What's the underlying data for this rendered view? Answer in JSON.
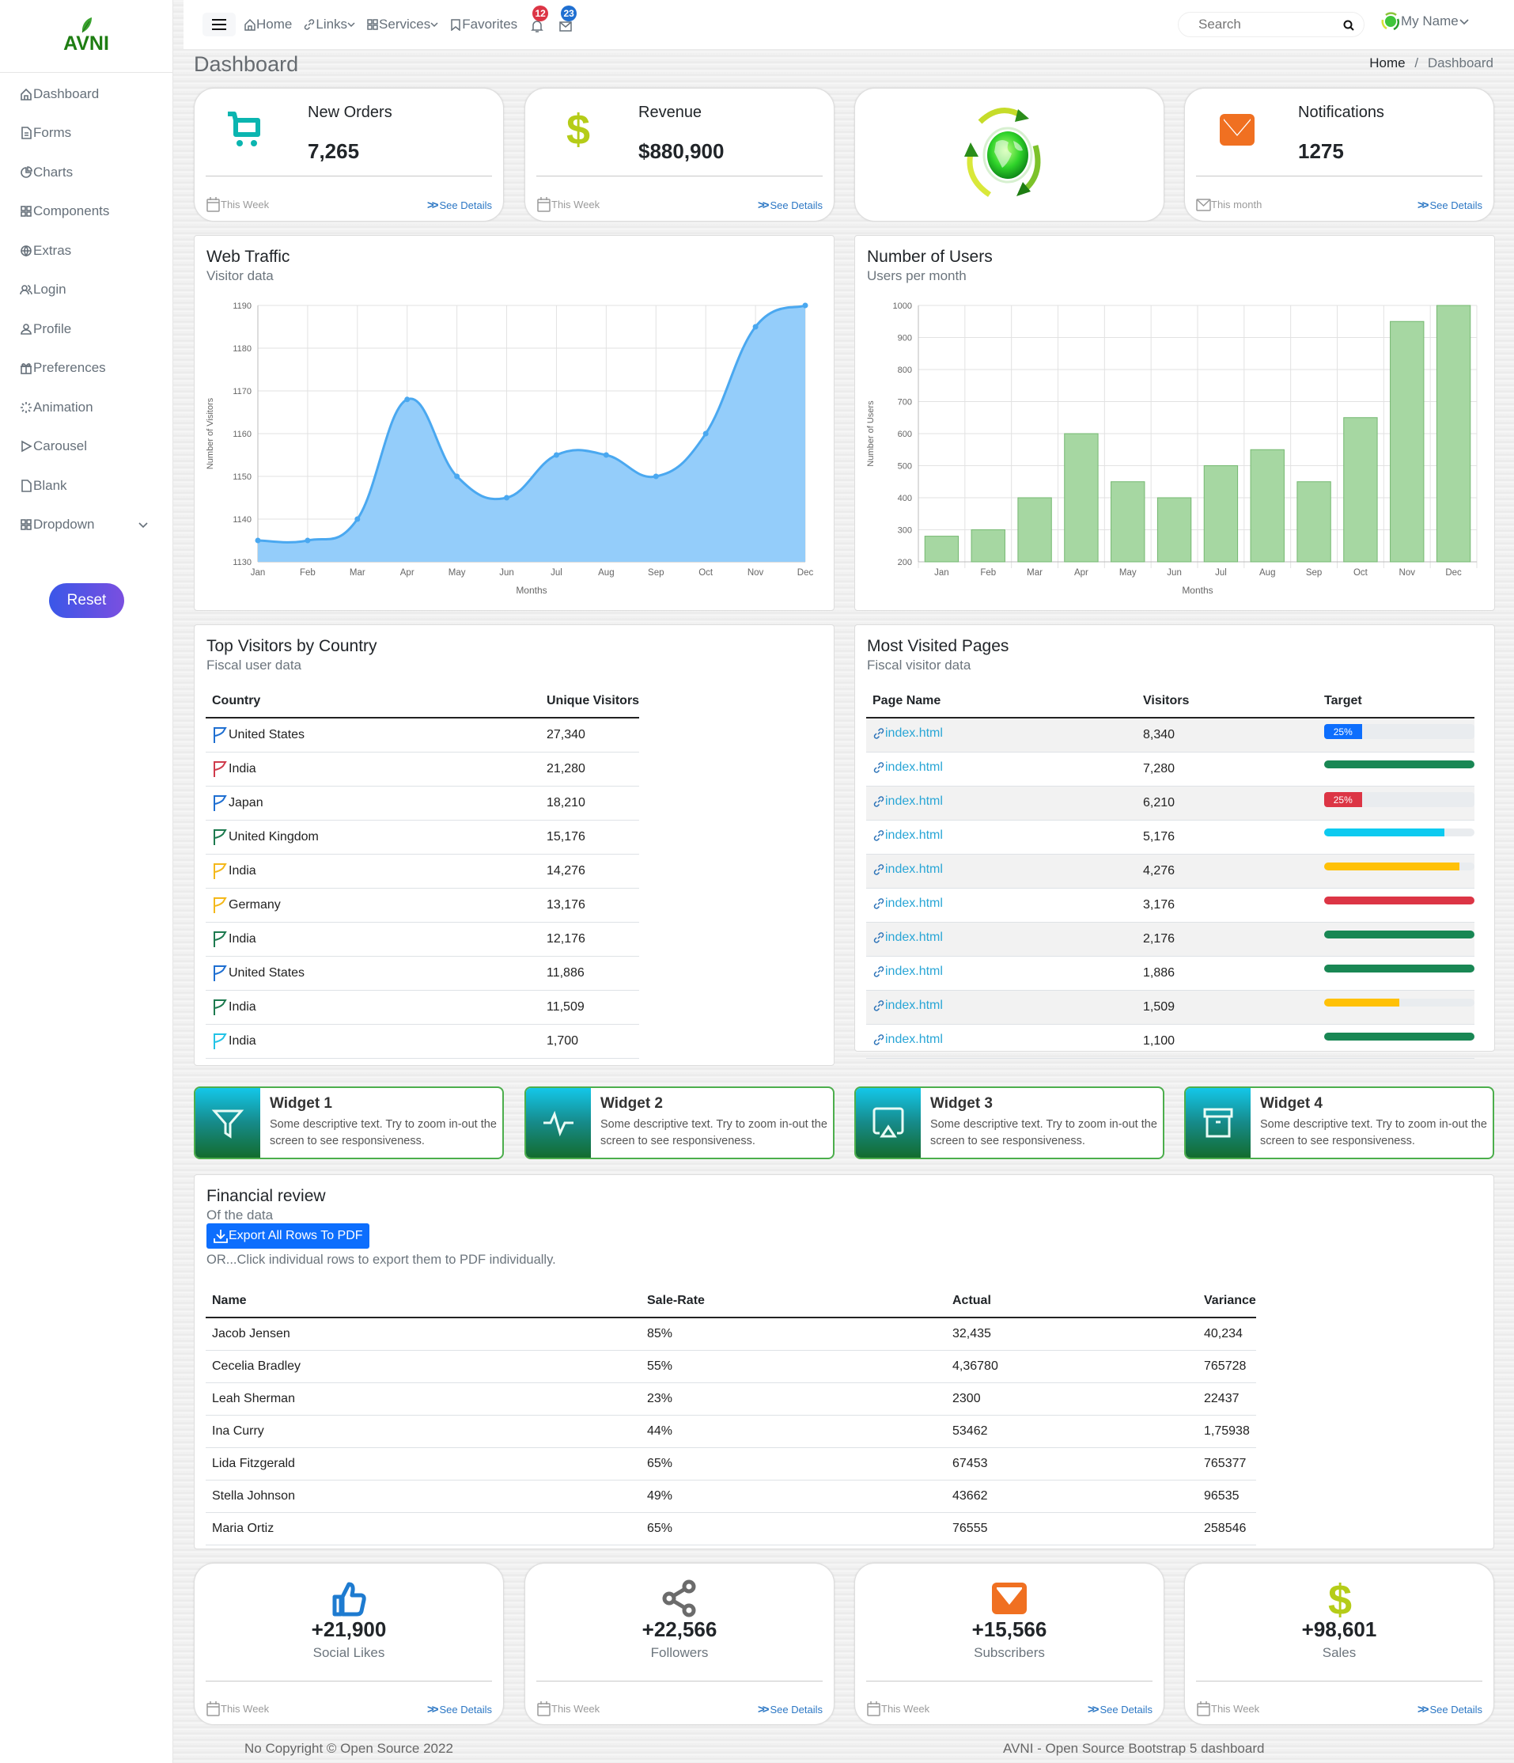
{
  "brand": {
    "name": "AVNI",
    "color": "#1e7d12"
  },
  "sidebar": {
    "items": [
      {
        "label": "Dashboard",
        "icon": "home-icon"
      },
      {
        "label": "Forms",
        "icon": "file-text-icon"
      },
      {
        "label": "Charts",
        "icon": "pie-chart-icon"
      },
      {
        "label": "Components",
        "icon": "grid-icon"
      },
      {
        "label": "Extras",
        "icon": "globe-icon"
      },
      {
        "label": "Login",
        "icon": "users-icon"
      },
      {
        "label": "Profile",
        "icon": "user-icon"
      },
      {
        "label": "Preferences",
        "icon": "gift-icon"
      },
      {
        "label": "Animation",
        "icon": "loader-icon"
      },
      {
        "label": "Carousel",
        "icon": "play-icon"
      },
      {
        "label": "Blank",
        "icon": "file-icon"
      },
      {
        "label": "Dropdown",
        "icon": "grid-icon",
        "has_chevron": true
      }
    ],
    "reset_label": "Reset"
  },
  "header": {
    "nav": [
      {
        "label": "Home",
        "icon": "home-icon"
      },
      {
        "label": "Links",
        "icon": "link-icon",
        "dropdown": true
      },
      {
        "label": "Services",
        "icon": "grid-icon",
        "dropdown": true
      },
      {
        "label": "Favorites",
        "icon": "bookmark-icon"
      }
    ],
    "notifications_count": "12",
    "messages_count": "23",
    "search_placeholder": "Search",
    "user_name": "My Name"
  },
  "page": {
    "title": "Dashboard",
    "breadcrumb": [
      "Home",
      "Dashboard"
    ]
  },
  "stats": [
    {
      "title": "New Orders",
      "value": "7,265",
      "period": "This Week",
      "link": "See Details",
      "icon": "cart-icon",
      "color": "#0bb5b0"
    },
    {
      "title": "Revenue",
      "value": "$880,900",
      "period": "This Week",
      "link": "See Details",
      "icon": "dollar-icon",
      "color": "#b5cc18"
    },
    {
      "title": "",
      "value": "",
      "icon": "recycle-globe-icon"
    },
    {
      "title": "Notifications",
      "value": "1275",
      "period": "This month",
      "link": "See Details",
      "icon": "mail-icon",
      "color": "#f07021"
    }
  ],
  "web_traffic": {
    "title": "Web Traffic",
    "subtitle": "Visitor data"
  },
  "users_chart": {
    "title": "Number of Users",
    "subtitle": "Users per month"
  },
  "chart_data": [
    {
      "type": "area",
      "title": "Web Traffic",
      "xlabel": "Months",
      "ylabel": "Number of Visitors",
      "categories": [
        "Jan",
        "Feb",
        "Mar",
        "Apr",
        "May",
        "Jun",
        "Jul",
        "Aug",
        "Sep",
        "Oct",
        "Nov",
        "Dec"
      ],
      "values": [
        1135,
        1135,
        1140,
        1168,
        1150,
        1145,
        1155,
        1155,
        1150,
        1160,
        1185,
        1190
      ],
      "ylim": [
        1130,
        1190
      ],
      "yticks": [
        1130,
        1140,
        1150,
        1160,
        1170,
        1180,
        1190
      ],
      "grid": true,
      "color": "#4aa8f0",
      "fill": "#94cdfa"
    },
    {
      "type": "bar",
      "title": "Number of Users",
      "xlabel": "Months",
      "ylabel": "Number of Users",
      "categories": [
        "Jan",
        "Feb",
        "Mar",
        "Apr",
        "May",
        "Jun",
        "Jul",
        "Aug",
        "Sep",
        "Oct",
        "Nov",
        "Dec"
      ],
      "values": [
        280,
        300,
        400,
        600,
        450,
        400,
        500,
        550,
        450,
        650,
        950,
        1000
      ],
      "ylim": [
        200,
        1000
      ],
      "yticks": [
        200,
        300,
        400,
        500,
        600,
        700,
        800,
        900,
        1000
      ],
      "grid": true,
      "color": "#a6d7a2",
      "border": "#74b870"
    }
  ],
  "countries": {
    "title": "Top Visitors by Country",
    "subtitle": "Fiscal user data",
    "columns": [
      "Country",
      "Unique Visitors"
    ],
    "rows": [
      {
        "country": "United States",
        "visitors": "27,340",
        "flag_color": "#1f6fd1"
      },
      {
        "country": "India",
        "visitors": "21,280",
        "flag_color": "#cf3b4b"
      },
      {
        "country": "Japan",
        "visitors": "18,210",
        "flag_color": "#1f6fd1"
      },
      {
        "country": "United Kingdom",
        "visitors": "15,176",
        "flag_color": "#1d7a4f"
      },
      {
        "country": "India",
        "visitors": "14,276",
        "flag_color": "#f4b81a"
      },
      {
        "country": "Germany",
        "visitors": "13,176",
        "flag_color": "#f4b81a"
      },
      {
        "country": "India",
        "visitors": "12,176",
        "flag_color": "#1d7a4f"
      },
      {
        "country": "United States",
        "visitors": "11,886",
        "flag_color": "#1f6fd1"
      },
      {
        "country": "India",
        "visitors": "11,509",
        "flag_color": "#1d7a4f"
      },
      {
        "country": "India",
        "visitors": "1,700",
        "flag_color": "#22c3e6"
      }
    ]
  },
  "pages": {
    "title": "Most Visited Pages",
    "subtitle": "Fiscal visitor data",
    "columns": [
      "Page Name",
      "Visitors",
      "Target"
    ],
    "rows": [
      {
        "page": "index.html",
        "visitors": "8,340",
        "target_pct": 25,
        "label": "25%",
        "color": "#0d6efd"
      },
      {
        "page": "index.html",
        "visitors": "7,280",
        "target_pct": 100,
        "label": "",
        "color": "#198754"
      },
      {
        "page": "index.html",
        "visitors": "6,210",
        "target_pct": 25,
        "label": "25%",
        "color": "#dc3545"
      },
      {
        "page": "index.html",
        "visitors": "5,176",
        "target_pct": 80,
        "label": "",
        "color": "#0dcaf0"
      },
      {
        "page": "index.html",
        "visitors": "4,276",
        "target_pct": 90,
        "label": "",
        "color": "#ffc107"
      },
      {
        "page": "index.html",
        "visitors": "3,176",
        "target_pct": 100,
        "label": "",
        "color": "#dc3545"
      },
      {
        "page": "index.html",
        "visitors": "2,176",
        "target_pct": 100,
        "label": "",
        "color": "#198754"
      },
      {
        "page": "index.html",
        "visitors": "1,886",
        "target_pct": 100,
        "label": "",
        "color": "#198754"
      },
      {
        "page": "index.html",
        "visitors": "1,509",
        "target_pct": 50,
        "label": "",
        "color": "#ffc107"
      },
      {
        "page": "index.html",
        "visitors": "1,100",
        "target_pct": 100,
        "label": "",
        "color": "#198754"
      }
    ]
  },
  "widgets": [
    {
      "title": "Widget 1",
      "text": "Some descriptive text. Try to zoom in-out the screen to see responsiveness.",
      "icon": "filter-icon"
    },
    {
      "title": "Widget 2",
      "text": "Some descriptive text. Try to zoom in-out the screen to see responsiveness.",
      "icon": "activity-icon"
    },
    {
      "title": "Widget 3",
      "text": "Some descriptive text. Try to zoom in-out the screen to see responsiveness.",
      "icon": "airplay-icon"
    },
    {
      "title": "Widget 4",
      "text": "Some descriptive text. Try to zoom in-out the screen to see responsiveness.",
      "icon": "archive-icon"
    }
  ],
  "financial": {
    "title": "Financial review",
    "subtitle": "Of the data",
    "export_label": "Export All Rows To PDF",
    "note": "OR...Click individual rows to export them to PDF individually.",
    "columns": [
      "Name",
      "Sale-Rate",
      "Actual",
      "Variance"
    ],
    "rows": [
      [
        "Jacob Jensen",
        "85%",
        "32,435",
        "40,234"
      ],
      [
        "Cecelia Bradley",
        "55%",
        "4,36780",
        "765728"
      ],
      [
        "Leah Sherman",
        "23%",
        "2300",
        "22437"
      ],
      [
        "Ina Curry",
        "44%",
        "53462",
        "1,75938"
      ],
      [
        "Lida Fitzgerald",
        "65%",
        "67453",
        "765377"
      ],
      [
        "Stella Johnson",
        "49%",
        "43662",
        "96535"
      ],
      [
        "Maria Ortiz",
        "65%",
        "76555",
        "258546"
      ]
    ]
  },
  "social": [
    {
      "value": "+21,900",
      "label": "Social Likes",
      "period": "This Week",
      "link": "See Details",
      "icon": "thumbs-up-icon",
      "color": "#1e7bd0"
    },
    {
      "value": "+22,566",
      "label": "Followers",
      "period": "This Week",
      "link": "See Details",
      "icon": "share-icon",
      "color": "#6b6b6b"
    },
    {
      "value": "+15,566",
      "label": "Subscribers",
      "period": "This Week",
      "link": "See Details",
      "icon": "mail-icon",
      "color": "#f07021"
    },
    {
      "value": "+98,601",
      "label": "Sales",
      "period": "This Week",
      "link": "See Details",
      "icon": "dollar-icon",
      "color": "#b5cc18"
    }
  ],
  "footer": {
    "left": "No Copyright © Open Source 2022",
    "right": "AVNI - Open Source Bootstrap 5 dashboard"
  }
}
